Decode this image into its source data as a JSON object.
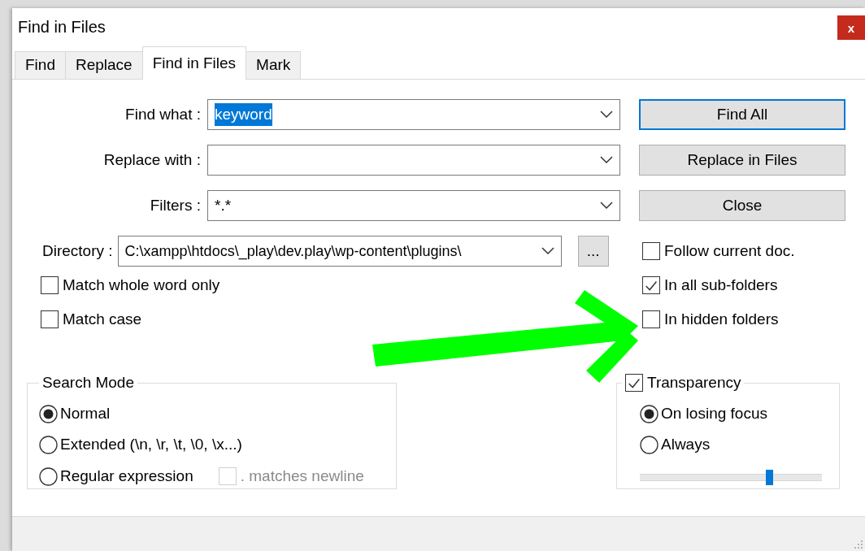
{
  "window": {
    "title": "Find in Files",
    "close": "x"
  },
  "tabs": [
    {
      "label": "Find",
      "selected": false
    },
    {
      "label": "Replace",
      "selected": false
    },
    {
      "label": "Find in Files",
      "selected": true
    },
    {
      "label": "Mark",
      "selected": false
    }
  ],
  "fields": [
    {
      "label": "Find what :",
      "value": "keyword",
      "text_selected": true
    },
    {
      "label": "Replace with :"
    },
    {
      "label": "Filters :",
      "value": "*.*",
      "text_selected": false
    }
  ],
  "buttons": [
    {
      "label": "Find All",
      "default": true
    },
    {
      "label": "Replace in Files",
      "default": false
    },
    {
      "label": "Close",
      "default": false
    }
  ],
  "directory": {
    "label": "Directory :",
    "value": "C:\\xampp\\htdocs\\_play\\dev.play\\wp-content\\plugins\\",
    "browse": "..."
  },
  "left_options": [
    {
      "label": "Match whole word only",
      "checked": false
    },
    {
      "label": "Match case",
      "checked": false
    }
  ],
  "folder_options": [
    {
      "label": "Follow current doc.",
      "checked": false
    },
    {
      "label": "In all sub-folders",
      "checked": true
    },
    {
      "label": "In hidden folders",
      "checked": false
    }
  ],
  "search_mode": {
    "title": "Search Mode",
    "options": [
      {
        "label": "Normal",
        "selected": true
      },
      {
        "label": "Extended (\\n, \\r, \\t, \\0, \\x...)",
        "selected": false
      },
      {
        "label": "Regular expression",
        "selected": false
      }
    ],
    "dot_matches_newline": {
      "label": ". matches newline",
      "checked": false,
      "disabled": true
    }
  },
  "transparency": {
    "label": "Transparency",
    "checked": true,
    "options": [
      {
        "label": "On losing focus",
        "selected": true
      },
      {
        "label": "Always",
        "selected": false
      }
    ],
    "level": 0.71
  }
}
